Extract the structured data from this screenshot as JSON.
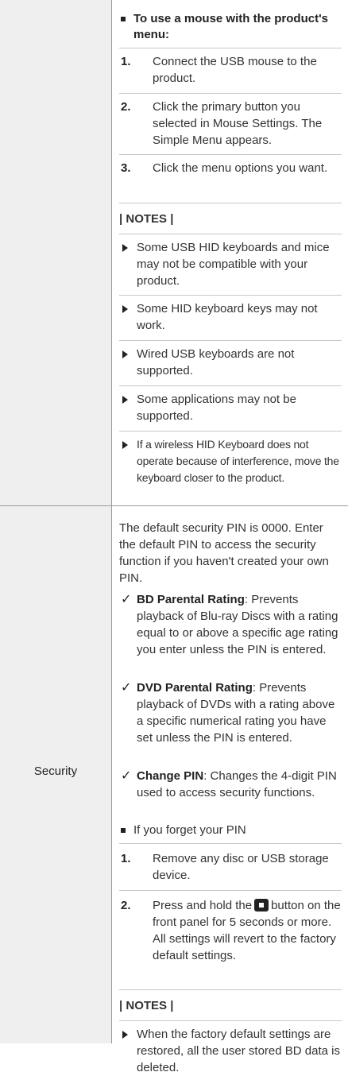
{
  "row1": {
    "lead": "To use a mouse with the product's menu:",
    "steps": [
      {
        "num": "1.",
        "text": "Connect the USB mouse to the product."
      },
      {
        "num": "2.",
        "text": "Click the primary button you selected in Mouse Settings. The Simple Menu appears."
      },
      {
        "num": "3.",
        "text": "Click the menu options you want."
      }
    ],
    "notes_title": "| NOTES |",
    "notes": [
      "Some USB HID keyboards and mice may not be compatible with your product.",
      "Some HID keyboard keys may not work.",
      "Wired USB keyboards are not supported.",
      "Some applications may not be supported.",
      "If a wireless HID Keyboard does not operate because of interference, move the keyboard closer to the product."
    ]
  },
  "row2": {
    "label": "Security",
    "intro": "The default security PIN is 0000. Enter the default PIN to access the security function if you haven't created your own PIN.",
    "checks": [
      {
        "term": "BD Parental Rating",
        "text": ": Prevents playback of Blu-ray Discs with a rating equal to or above a specific age rating you enter unless the PIN is entered."
      },
      {
        "term": "DVD Parental Rating",
        "text": ": Prevents playback of DVDs with a rating above a specific numerical rating you have set unless the PIN is entered."
      },
      {
        "term": "Change PIN",
        "text": ": Changes the 4-digit PIN used to access security functions."
      }
    ],
    "forgot": "If you forget your PIN",
    "step1": {
      "num": "1.",
      "text": "Remove any disc or USB storage device."
    },
    "step2": {
      "num": "2.",
      "pre": "Press and hold the",
      "post": "button on the front panel for 5 seconds or more.",
      "extra": "All settings will revert to the factory default settings."
    },
    "notes_title": "| NOTES |",
    "notes": [
      "When the factory default settings are restored, all the user stored BD data is deleted."
    ]
  }
}
